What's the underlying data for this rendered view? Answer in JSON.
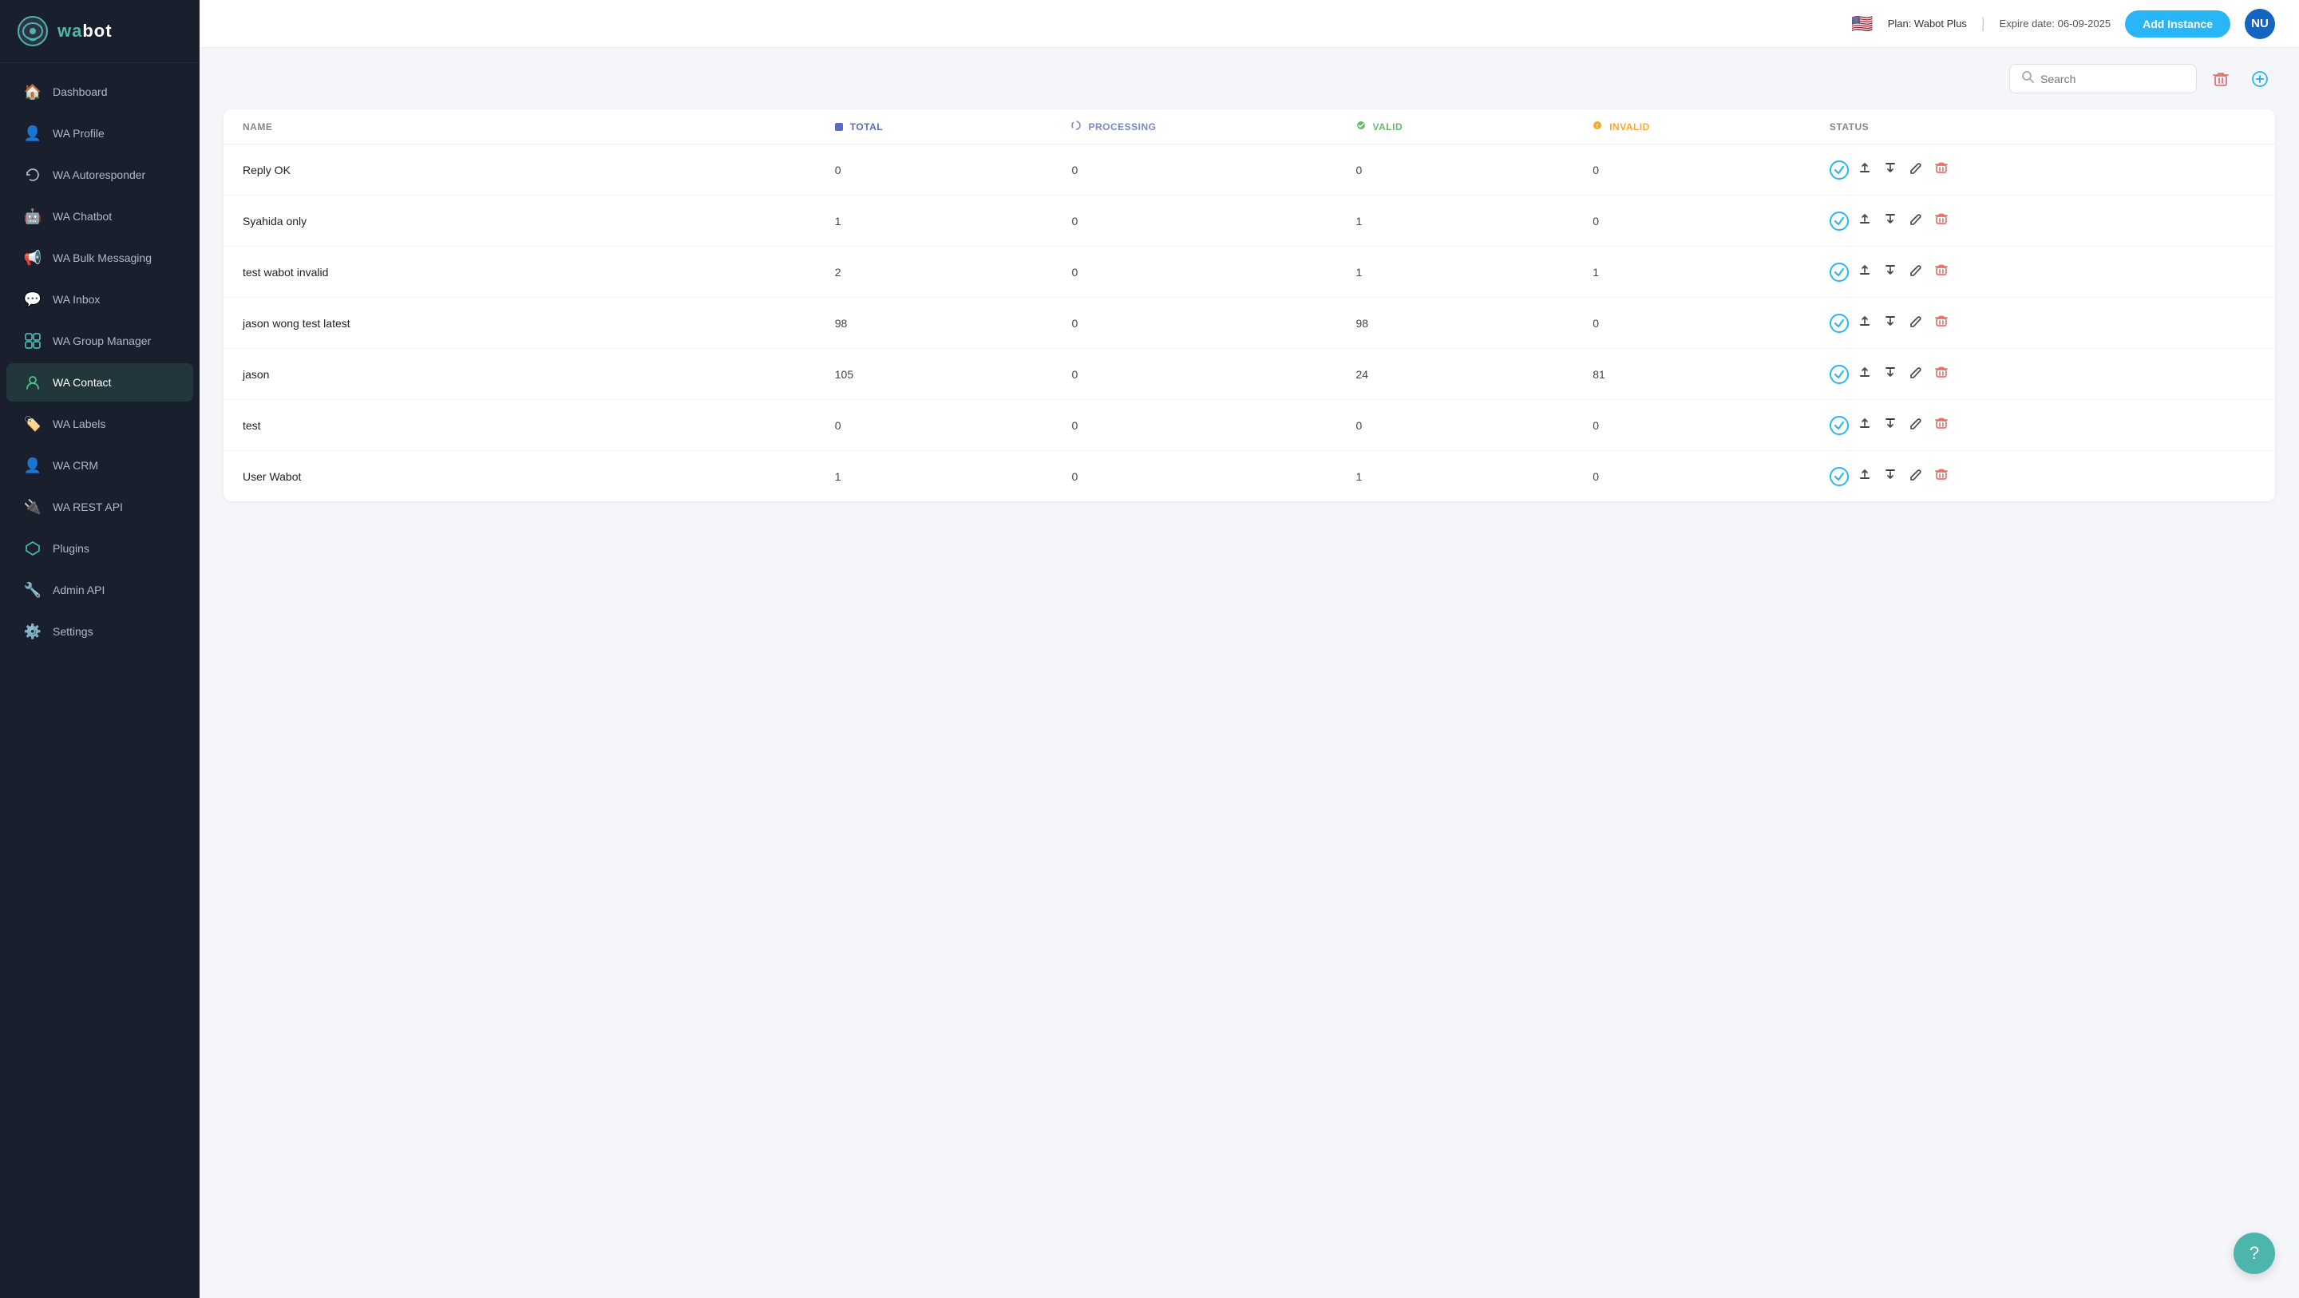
{
  "sidebar": {
    "logo": {
      "text": "wabot",
      "highlight": "wa"
    },
    "items": [
      {
        "id": "dashboard",
        "label": "Dashboard",
        "icon": "🏠",
        "active": false
      },
      {
        "id": "wa-profile",
        "label": "WA Profile",
        "icon": "👤",
        "active": false
      },
      {
        "id": "wa-autoresponder",
        "label": "WA Autoresponder",
        "icon": "↩️",
        "active": false
      },
      {
        "id": "wa-chatbot",
        "label": "WA Chatbot",
        "icon": "🤖",
        "active": false
      },
      {
        "id": "wa-bulk-messaging",
        "label": "WA Bulk Messaging",
        "icon": "📢",
        "active": false
      },
      {
        "id": "wa-inbox",
        "label": "WA Inbox",
        "icon": "💬",
        "active": false
      },
      {
        "id": "wa-group-manager",
        "label": "WA Group Manager",
        "icon": "👥",
        "active": false
      },
      {
        "id": "wa-contact",
        "label": "WA Contact",
        "icon": "📇",
        "active": true
      },
      {
        "id": "wa-labels",
        "label": "WA Labels",
        "icon": "🏷️",
        "active": false
      },
      {
        "id": "wa-crm",
        "label": "WA CRM",
        "icon": "👤",
        "active": false
      },
      {
        "id": "wa-rest-api",
        "label": "WA REST API",
        "icon": "🔌",
        "active": false
      },
      {
        "id": "plugins",
        "label": "Plugins",
        "icon": "🔷",
        "active": false
      },
      {
        "id": "admin-api",
        "label": "Admin API",
        "icon": "🔧",
        "active": false
      },
      {
        "id": "settings",
        "label": "Settings",
        "icon": "⚙️",
        "active": false
      }
    ]
  },
  "header": {
    "flag": "🇺🇸",
    "plan_label": "Plan: Wabot Plus",
    "expire_label": "Expire date: 06-09-2025",
    "add_instance_label": "Add Instance",
    "user_initials": "NU"
  },
  "search": {
    "placeholder": "Search"
  },
  "table": {
    "columns": {
      "name": "NAME",
      "total": "TOTAL",
      "processing": "PROCESSING",
      "valid": "VALID",
      "invalid": "INVALID",
      "status": "STATUS"
    },
    "rows": [
      {
        "name": "Reply OK",
        "total": 0,
        "processing": 0,
        "valid": 0,
        "invalid": 0
      },
      {
        "name": "Syahida only",
        "total": 1,
        "processing": 0,
        "valid": 1,
        "invalid": 0
      },
      {
        "name": "test wabot invalid",
        "total": 2,
        "processing": 0,
        "valid": 1,
        "invalid": 1
      },
      {
        "name": "jason wong test latest",
        "total": 98,
        "processing": 0,
        "valid": 98,
        "invalid": 0
      },
      {
        "name": "jason",
        "total": 105,
        "processing": 0,
        "valid": 24,
        "invalid": 81
      },
      {
        "name": "test",
        "total": 0,
        "processing": 0,
        "valid": 0,
        "invalid": 0
      },
      {
        "name": "User Wabot",
        "total": 1,
        "processing": 0,
        "valid": 1,
        "invalid": 0
      }
    ]
  },
  "help": {
    "icon": "?"
  }
}
